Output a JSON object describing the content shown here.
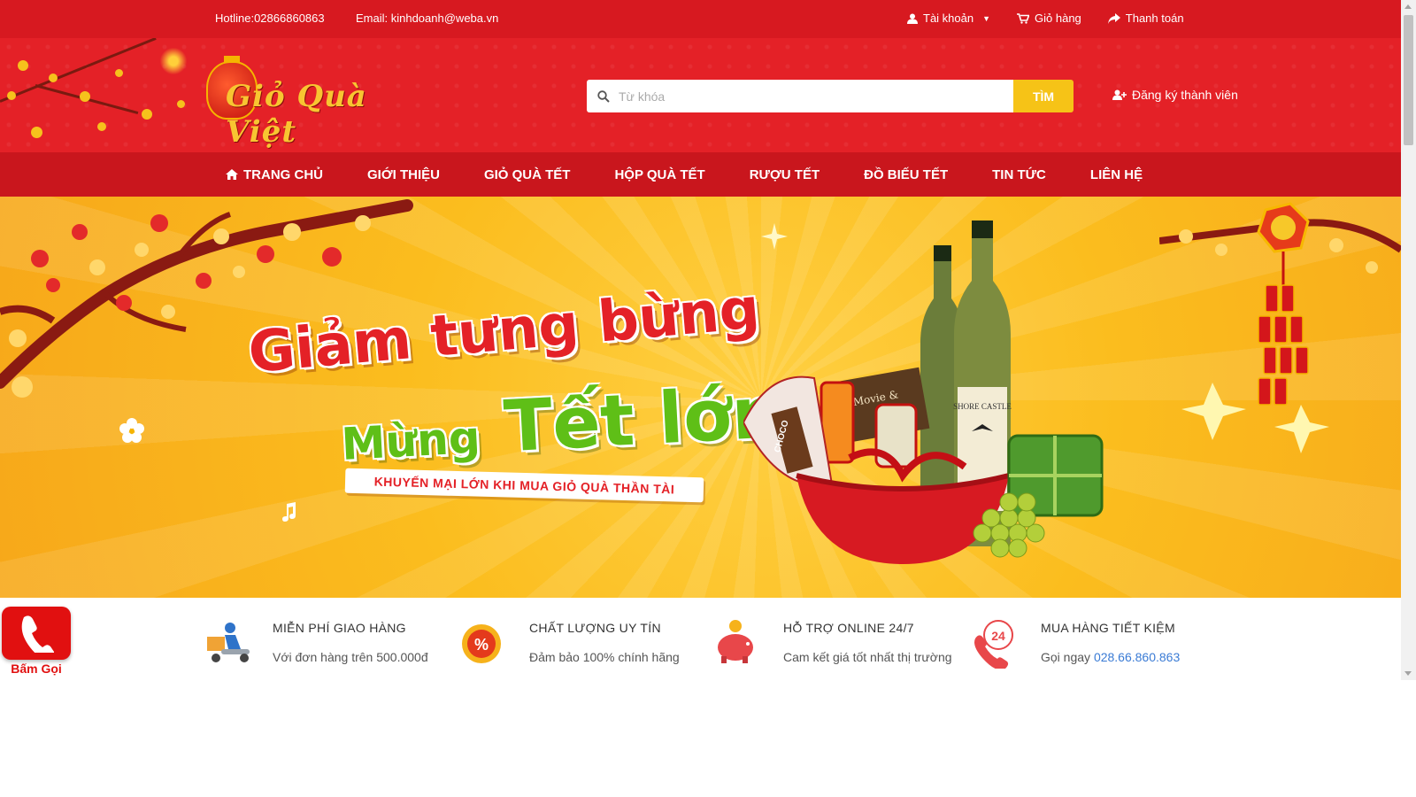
{
  "topbar": {
    "hotline": "Hotline:02866860863",
    "email": "Email: kinhdoanh@weba.vn",
    "account": "Tài khoản",
    "cart": "Giỏ hàng",
    "checkout": "Thanh toán"
  },
  "header": {
    "logo_text": "Giỏ Quà Việt",
    "search_placeholder": "Từ khóa",
    "search_button": "TÌM",
    "register": "Đăng ký thành viên"
  },
  "nav": {
    "items": [
      "TRANG CHỦ",
      "GIỚI THIỆU",
      "GIỎ QUÀ TẾT",
      "HỘP QUÀ TẾT",
      "RƯỢU TẾT",
      "ĐỒ BIẾU TẾT",
      "TIN TỨC",
      "LIÊN HỆ"
    ]
  },
  "banner": {
    "line1": "Giảm tưng bừng",
    "line2a": "Mừng",
    "line2b": "Tết lớn",
    "ribbon": "KHUYẾN MẠI LỚN KHI MUA GIỎ QUÀ THẦN TÀI",
    "bottle_label": "SHORE CASTLE",
    "choco_label": "CHOCO",
    "box_label": "Movie &"
  },
  "features": [
    {
      "title": "MIỄN PHÍ GIAO HÀNG",
      "desc": "Với đơn hàng trên 500.000đ",
      "icon": "delivery-icon"
    },
    {
      "title": "CHẤT LƯỢNG UY TÍN",
      "desc": "Đảm bảo 100% chính hãng",
      "icon": "percent-badge-icon"
    },
    {
      "title": "HỖ TRỢ ONLINE 24/7",
      "desc": "Cam kết giá tốt nhất thị trường",
      "icon": "piggy-bank-icon"
    },
    {
      "title": "MUA HÀNG TIẾT KIỆM",
      "desc_prefix": "Gọi ngay",
      "phone": "028.66.860.863",
      "icon": "phone-24-icon"
    }
  ],
  "call_button": {
    "label": "Bấm Gọi"
  },
  "colors": {
    "primary_red": "#d71920",
    "nav_red": "#c9161d",
    "accent_yellow": "#f6c317",
    "banner_orange": "#fbbd1e"
  }
}
